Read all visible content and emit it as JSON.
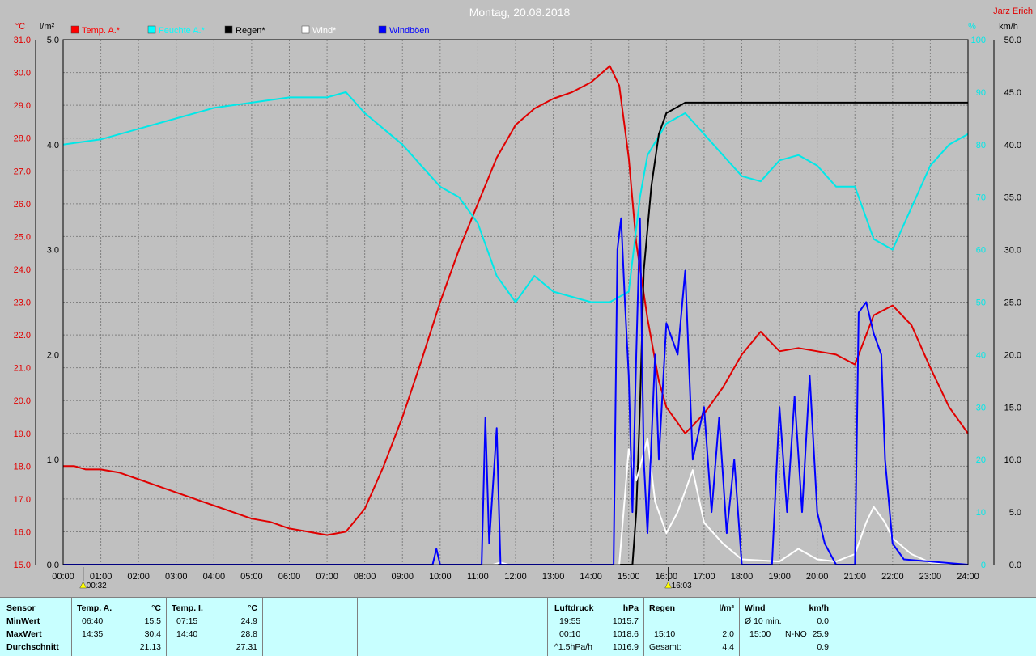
{
  "chart_data": {
    "type": "line",
    "title": "Montag, 20.08.2018",
    "author": "Jarz Erich",
    "axes": {
      "temp_unit": "°C",
      "rain_unit": "l/m²",
      "hum_unit": "%",
      "wind_unit": "km/h",
      "temp_range": [
        15.0,
        31.0
      ],
      "rain_range": [
        0.0,
        5.0
      ],
      "hum_range": [
        0,
        100
      ],
      "wind_range": [
        0.0,
        50.0
      ],
      "temp_ticks": [
        "31.0",
        "30.0",
        "29.0",
        "28.0",
        "27.0",
        "26.0",
        "25.0",
        "24.0",
        "23.0",
        "22.0",
        "21.0",
        "20.0",
        "19.0",
        "18.0",
        "17.0",
        "16.0",
        "15.0"
      ],
      "rain_ticks": [
        "5.0",
        "4.0",
        "3.0",
        "2.0",
        "1.0",
        "0.0"
      ],
      "hum_ticks": [
        "100",
        "90",
        "80",
        "70",
        "60",
        "50",
        "40",
        "30",
        "20",
        "10",
        "0"
      ],
      "wind_ticks": [
        "50.0",
        "45.0",
        "40.0",
        "35.0",
        "30.0",
        "25.0",
        "20.0",
        "15.0",
        "10.0",
        "5.0",
        "0.0"
      ],
      "x_ticks": [
        "00:00",
        "01:00",
        "02:00",
        "03:00",
        "04:00",
        "05:00",
        "06:00",
        "07:00",
        "08:00",
        "09:00",
        "10:00",
        "11:00",
        "12:00",
        "13:00",
        "14:00",
        "15:00",
        "16:00",
        "17:00",
        "18:00",
        "19:00",
        "20:00",
        "21:00",
        "22:00",
        "23:00",
        "24:00"
      ]
    },
    "markers": [
      {
        "hour": 0.53,
        "label": "00:32"
      },
      {
        "hour": 16.05,
        "label": "16:03"
      }
    ],
    "legend": [
      {
        "name": "Temp. A.*",
        "color": "#ff0000"
      },
      {
        "name": "Feuchte A.*",
        "color": "#00ffff"
      },
      {
        "name": "Regen*",
        "color": "#000000"
      },
      {
        "name": "Wind*",
        "color": "#ffffff"
      },
      {
        "name": "Windböen",
        "color": "#0000ff"
      }
    ],
    "series": [
      {
        "name": "Temp. A.*",
        "axis": "temp",
        "color": "#e00000",
        "points": [
          [
            0,
            18.0
          ],
          [
            0.3,
            18.0
          ],
          [
            0.6,
            17.9
          ],
          [
            1,
            17.9
          ],
          [
            1.5,
            17.8
          ],
          [
            2,
            17.6
          ],
          [
            2.5,
            17.4
          ],
          [
            3,
            17.2
          ],
          [
            3.5,
            17.0
          ],
          [
            4,
            16.8
          ],
          [
            4.5,
            16.6
          ],
          [
            5,
            16.4
          ],
          [
            5.5,
            16.3
          ],
          [
            6,
            16.1
          ],
          [
            6.5,
            16.0
          ],
          [
            7,
            15.9
          ],
          [
            7.5,
            16.0
          ],
          [
            8,
            16.7
          ],
          [
            8.5,
            18.0
          ],
          [
            9,
            19.5
          ],
          [
            9.5,
            21.2
          ],
          [
            10,
            23.0
          ],
          [
            10.5,
            24.6
          ],
          [
            11,
            26.0
          ],
          [
            11.5,
            27.4
          ],
          [
            12,
            28.4
          ],
          [
            12.5,
            28.9
          ],
          [
            13,
            29.2
          ],
          [
            13.5,
            29.4
          ],
          [
            14,
            29.7
          ],
          [
            14.5,
            30.2
          ],
          [
            14.75,
            29.6
          ],
          [
            15,
            27.4
          ],
          [
            15.2,
            24.8
          ],
          [
            15.5,
            22.5
          ],
          [
            15.8,
            20.6
          ],
          [
            16,
            19.8
          ],
          [
            16.5,
            19.0
          ],
          [
            17,
            19.6
          ],
          [
            17.5,
            20.4
          ],
          [
            18,
            21.4
          ],
          [
            18.5,
            22.1
          ],
          [
            19,
            21.5
          ],
          [
            19.5,
            21.6
          ],
          [
            20,
            21.5
          ],
          [
            20.5,
            21.4
          ],
          [
            21,
            21.1
          ],
          [
            21.5,
            22.6
          ],
          [
            22,
            22.9
          ],
          [
            22.5,
            22.3
          ],
          [
            23,
            21.0
          ],
          [
            23.5,
            19.8
          ],
          [
            24,
            19.0
          ]
        ]
      },
      {
        "name": "Feuchte A.*",
        "axis": "hum",
        "color": "#00e8e8",
        "points": [
          [
            0,
            80
          ],
          [
            1,
            81
          ],
          [
            2,
            83
          ],
          [
            3,
            85
          ],
          [
            4,
            87
          ],
          [
            5,
            88
          ],
          [
            6,
            89
          ],
          [
            7,
            89
          ],
          [
            7.5,
            90
          ],
          [
            8,
            86
          ],
          [
            8.5,
            83
          ],
          [
            9,
            80
          ],
          [
            9.5,
            76
          ],
          [
            10,
            72
          ],
          [
            10.5,
            70
          ],
          [
            11,
            65
          ],
          [
            11.5,
            55
          ],
          [
            12,
            50
          ],
          [
            12.5,
            55
          ],
          [
            13,
            52
          ],
          [
            13.5,
            51
          ],
          [
            14,
            50
          ],
          [
            14.5,
            50
          ],
          [
            15,
            52
          ],
          [
            15.3,
            70
          ],
          [
            15.5,
            78
          ],
          [
            16,
            84
          ],
          [
            16.5,
            86
          ],
          [
            17,
            82
          ],
          [
            17.5,
            78
          ],
          [
            18,
            74
          ],
          [
            18.5,
            73
          ],
          [
            19,
            77
          ],
          [
            19.5,
            78
          ],
          [
            20,
            76
          ],
          [
            20.5,
            72
          ],
          [
            21,
            72
          ],
          [
            21.5,
            62
          ],
          [
            22,
            60
          ],
          [
            22.5,
            68
          ],
          [
            23,
            76
          ],
          [
            23.5,
            80
          ],
          [
            24,
            82
          ]
        ]
      },
      {
        "name": "Regen*",
        "axis": "rain",
        "color": "#000000",
        "points": [
          [
            0,
            0
          ],
          [
            15.1,
            0
          ],
          [
            15.2,
            0.5
          ],
          [
            15.3,
            1.5
          ],
          [
            15.4,
            2.8
          ],
          [
            15.6,
            3.6
          ],
          [
            15.8,
            4.1
          ],
          [
            16,
            4.3
          ],
          [
            16.5,
            4.4
          ],
          [
            17,
            4.4
          ],
          [
            18,
            4.4
          ],
          [
            24,
            4.4
          ]
        ]
      },
      {
        "name": "Wind*",
        "axis": "wind",
        "color": "#ffffff",
        "points": [
          [
            0,
            0
          ],
          [
            11.4,
            0
          ],
          [
            11.6,
            0.2
          ],
          [
            11.8,
            0
          ],
          [
            14.75,
            0
          ],
          [
            15,
            11
          ],
          [
            15.2,
            8
          ],
          [
            15.5,
            12
          ],
          [
            15.7,
            6
          ],
          [
            16,
            3
          ],
          [
            16.3,
            5
          ],
          [
            16.5,
            7
          ],
          [
            16.7,
            9
          ],
          [
            17,
            4
          ],
          [
            17.5,
            2
          ],
          [
            18,
            0.5
          ],
          [
            19,
            0.3
          ],
          [
            19.5,
            1.5
          ],
          [
            20,
            0.5
          ],
          [
            20.5,
            0.3
          ],
          [
            21,
            1
          ],
          [
            21.3,
            4
          ],
          [
            21.5,
            5.5
          ],
          [
            21.8,
            4
          ],
          [
            22,
            2.5
          ],
          [
            22.5,
            1
          ],
          [
            23,
            0.2
          ],
          [
            24,
            0
          ]
        ]
      },
      {
        "name": "Windböen",
        "axis": "wind",
        "color": "#0000ff",
        "points": [
          [
            0,
            0
          ],
          [
            9.8,
            0
          ],
          [
            9.9,
            1.5
          ],
          [
            10,
            0
          ],
          [
            11.1,
            0
          ],
          [
            11.2,
            14
          ],
          [
            11.3,
            2
          ],
          [
            11.5,
            13
          ],
          [
            11.6,
            0
          ],
          [
            14.6,
            0
          ],
          [
            14.7,
            30
          ],
          [
            14.8,
            33
          ],
          [
            14.9,
            25
          ],
          [
            15.0,
            18
          ],
          [
            15.1,
            5
          ],
          [
            15.2,
            20
          ],
          [
            15.3,
            33
          ],
          [
            15.4,
            10
          ],
          [
            15.5,
            3
          ],
          [
            15.7,
            20
          ],
          [
            15.8,
            10
          ],
          [
            16,
            23
          ],
          [
            16.3,
            20
          ],
          [
            16.5,
            28
          ],
          [
            16.7,
            10
          ],
          [
            17,
            15
          ],
          [
            17.2,
            5
          ],
          [
            17.4,
            14
          ],
          [
            17.6,
            3
          ],
          [
            17.8,
            10
          ],
          [
            18,
            0
          ],
          [
            18.8,
            0
          ],
          [
            19,
            15
          ],
          [
            19.2,
            5
          ],
          [
            19.4,
            16
          ],
          [
            19.6,
            5
          ],
          [
            19.8,
            18
          ],
          [
            20,
            5
          ],
          [
            20.2,
            2
          ],
          [
            20.5,
            0
          ],
          [
            21,
            0
          ],
          [
            21.1,
            24
          ],
          [
            21.3,
            25
          ],
          [
            21.5,
            22
          ],
          [
            21.7,
            20
          ],
          [
            21.8,
            10
          ],
          [
            22,
            2
          ],
          [
            22.3,
            0.5
          ],
          [
            24,
            0
          ]
        ]
      }
    ]
  },
  "table": {
    "sensor": {
      "header": "Sensor",
      "min": "MinWert",
      "max": "MaxWert",
      "avg": "Durchschnitt"
    },
    "temp_a": {
      "header": "Temp. A.",
      "unit": "°C",
      "min_time": "06:40",
      "min_val": "15.5",
      "max_time": "14:35",
      "max_val": "30.4",
      "avg": "21.13"
    },
    "temp_i": {
      "header": "Temp. I.",
      "unit": "°C",
      "min_time": "07:15",
      "min_val": "24.9",
      "max_time": "14:40",
      "max_val": "28.8",
      "avg": "27.31"
    },
    "pressure": {
      "header": "Luftdruck",
      "unit": "hPa",
      "min_time": "19:55",
      "min_val": "1015.7",
      "max_time": "00:10",
      "max_val": "1018.6",
      "avg_label": "^1.5hPa/h",
      "avg": "1016.9"
    },
    "rain": {
      "header": "Regen",
      "unit": "l/m²",
      "max_time": "15:10",
      "max_val": "2.0",
      "total_label": "Gesamt:",
      "total": "4.4"
    },
    "wind": {
      "header": "Wind",
      "unit": "km/h",
      "min_label": "Ø 10 min.",
      "min_val": "0.0",
      "max_time": "15:00",
      "max_dir": "N-NO",
      "max_val": "25.9",
      "avg": "0.9"
    }
  }
}
